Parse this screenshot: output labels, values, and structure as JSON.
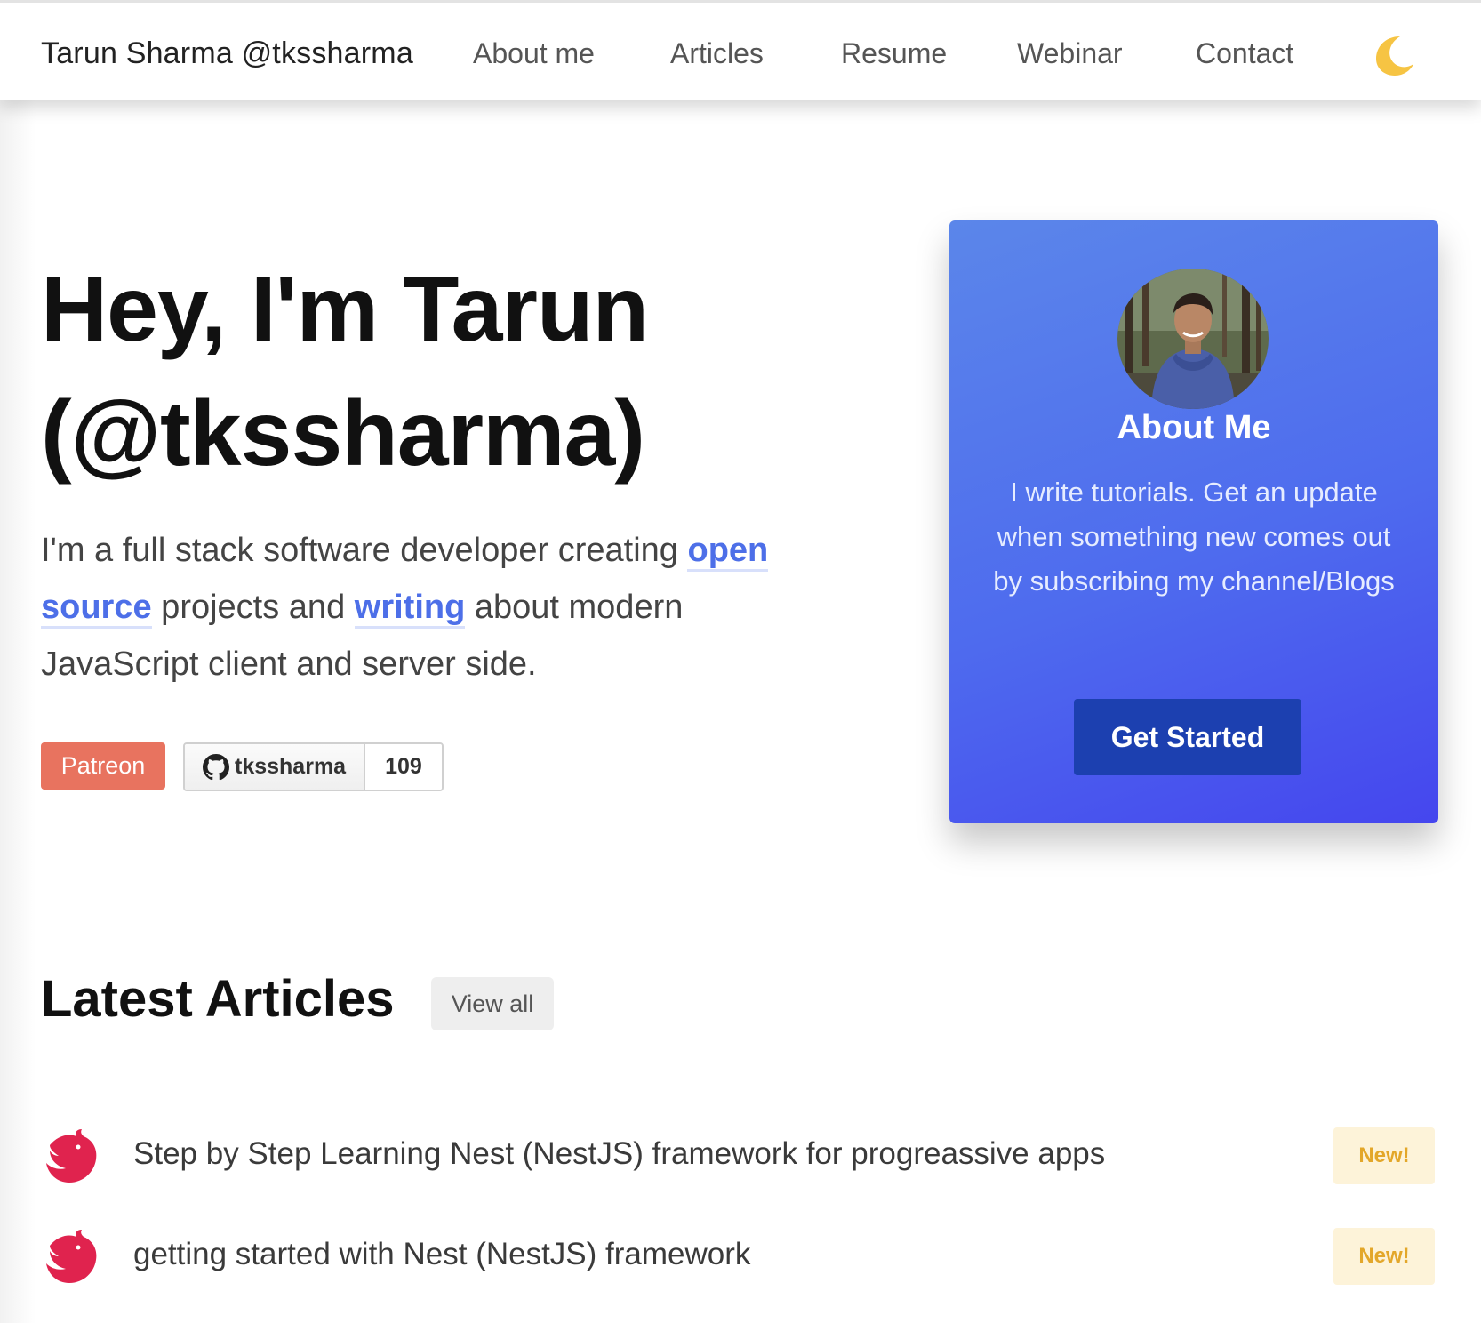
{
  "nav": {
    "brand": "Tarun Sharma @tkssharma",
    "links": [
      "About me",
      "Articles",
      "Resume",
      "Webinar",
      "Contact"
    ],
    "theme_icon": "moon-icon"
  },
  "hero": {
    "title_line1": "Hey, I'm Tarun",
    "title_line2": "(@tkssharma)",
    "desc_part1": "I'm a full stack software developer creating ",
    "link_open_source": "open source",
    "desc_part2": " projects and ",
    "link_writing": "writing",
    "desc_part3": " about modern JavaScript client and server side.",
    "patreon_label": "Patreon",
    "github_user": "tkssharma",
    "github_count": "109"
  },
  "card": {
    "title": "About Me",
    "text": "I write tutorials. Get an update when something new comes out by subscribing my channel/Blogs",
    "button": "Get Started"
  },
  "articles": {
    "heading": "Latest Articles",
    "view_all": "View all",
    "items": [
      {
        "title": "Step by Step Learning Nest (NestJS) framework for progreassive apps",
        "badge": "New!",
        "icon": "nestjs-logo-icon"
      },
      {
        "title": "getting started with Nest (NestJS) framework",
        "badge": "New!",
        "icon": "nestjs-logo-icon"
      }
    ]
  },
  "colors": {
    "accent_link": "#4d6fe8",
    "patreon": "#e8735f",
    "card_gradient_start": "#5b86ea",
    "card_gradient_end": "#4546ee",
    "card_button": "#1c40b0",
    "new_badge_bg": "#fdf3d9",
    "new_badge_text": "#e3a72a",
    "nest_red": "#e0234e"
  }
}
